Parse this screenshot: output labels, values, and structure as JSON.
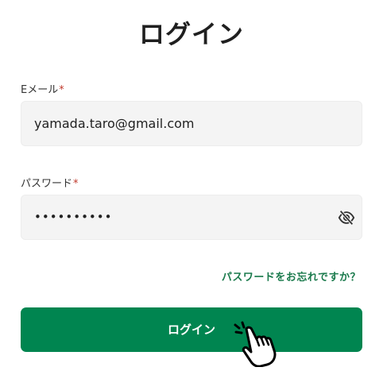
{
  "header": {
    "title": "ログイン"
  },
  "form": {
    "email": {
      "label": "Eメール",
      "required_mark": "*",
      "value": "yamada.taro@gmail.com"
    },
    "password": {
      "label": "パスワード",
      "required_mark": "*",
      "value": "••••••••••",
      "toggle_icon": "eye-off-icon"
    },
    "forgot_link": "パスワードをお忘れですか？",
    "submit_label": "ログイン"
  },
  "colors": {
    "accent": "#008550",
    "link": "#1a7a4c",
    "required": "#c0392b",
    "field_bg": "#f4f4f4"
  },
  "cursor": {
    "icon": "pointer-hand-icon"
  }
}
